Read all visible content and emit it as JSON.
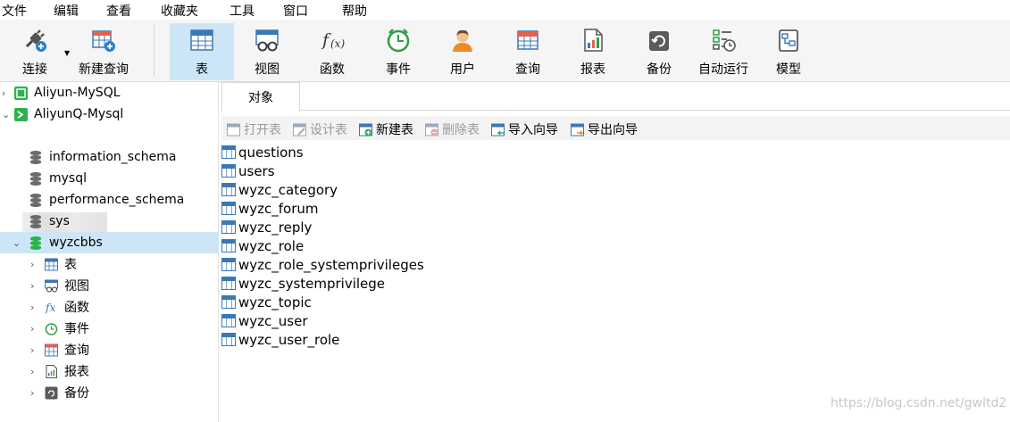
{
  "menu": [
    "文件",
    "编辑",
    "查看",
    "收藏夹",
    "工具",
    "窗口",
    "帮助"
  ],
  "toolbar": {
    "connect": "连接",
    "new_query": "新建查询",
    "table": "表",
    "view": "视图",
    "function": "函数",
    "event": "事件",
    "user": "用户",
    "query": "查询",
    "report": "报表",
    "backup": "备份",
    "auto_run": "自动运行",
    "model": "模型"
  },
  "tree": {
    "connections": [
      "Aliyun-MySQL",
      "AliyunQ-Mysql"
    ],
    "databases": [
      "information_schema",
      "mysql",
      "performance_schema",
      "sys",
      "wyzcbbs"
    ],
    "children": [
      "表",
      "视图",
      "函数",
      "事件",
      "查询",
      "报表",
      "备份"
    ]
  },
  "tab": "对象",
  "actions": {
    "open": "打开表",
    "design": "设计表",
    "new": "新建表",
    "delete": "删除表",
    "import": "导入向导",
    "export": "导出向导"
  },
  "tables": [
    "questions",
    "users",
    "wyzc_category",
    "wyzc_forum",
    "wyzc_reply",
    "wyzc_role",
    "wyzc_role_systemprivileges",
    "wyzc_systemprivilege",
    "wyzc_topic",
    "wyzc_user",
    "wyzc_user_role"
  ],
  "watermark": "https://blog.csdn.net/gwltd2",
  "colors": {
    "selection": "#cde6f7",
    "accent": "#3a78b5",
    "green": "#2bb24c"
  }
}
